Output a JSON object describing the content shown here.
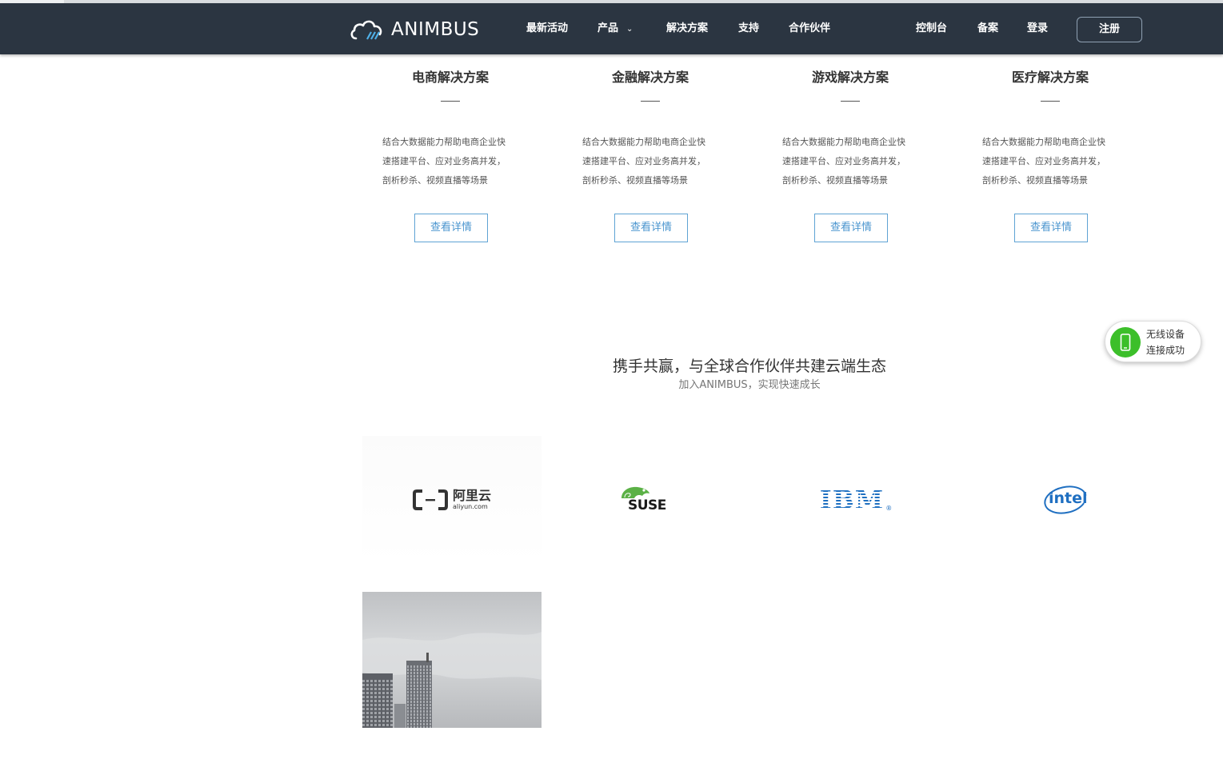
{
  "brand": {
    "name": "ANIMBUS"
  },
  "nav": {
    "items": [
      "最新活动",
      "产品",
      "解决方案",
      "支持",
      "合作伙伴"
    ],
    "right": [
      "控制台",
      "备案",
      "登录"
    ],
    "register": "注册"
  },
  "solutions": [
    {
      "title": "电商解决方案",
      "desc": [
        "结合大数据能力帮助电商企业快",
        "速搭建平台、应对业务高并发，",
        "剖析秒杀、视频直播等场景"
      ],
      "button": "查看详情"
    },
    {
      "title": "金融解决方案",
      "desc": [
        "结合大数据能力帮助电商企业快",
        "速搭建平台、应对业务高并发，",
        "剖析秒杀、视频直播等场景"
      ],
      "button": "查看详情"
    },
    {
      "title": "游戏解决方案",
      "desc": [
        "结合大数据能力帮助电商企业快",
        "速搭建平台、应对业务高并发，",
        "剖析秒杀、视频直播等场景"
      ],
      "button": "查看详情"
    },
    {
      "title": "医疗解决方案",
      "desc": [
        "结合大数据能力帮助电商企业快",
        "速搭建平台、应对业务高并发，",
        "剖析秒杀、视频直播等场景"
      ],
      "button": "查看详情"
    }
  ],
  "partners": {
    "title": "携手共赢，与全球合作伙伴共建云端生态",
    "subtitle": "加入ANIMBUS，实现快速成长",
    "logos": [
      {
        "name": "aliyun-logo",
        "text": "阿里云",
        "sub": "aliyun.com"
      },
      {
        "name": "suse-logo",
        "text": "SUSE"
      },
      {
        "name": "ibm-logo",
        "text": "IBM"
      },
      {
        "name": "intel-logo",
        "text": "intel"
      }
    ]
  },
  "toast": {
    "line1": "无线设备",
    "line2": "连接成功",
    "icon": "phone-icon",
    "color": "#3cbf2a"
  },
  "colors": {
    "navbar": "#2b3541",
    "accent": "#4a95cf"
  }
}
